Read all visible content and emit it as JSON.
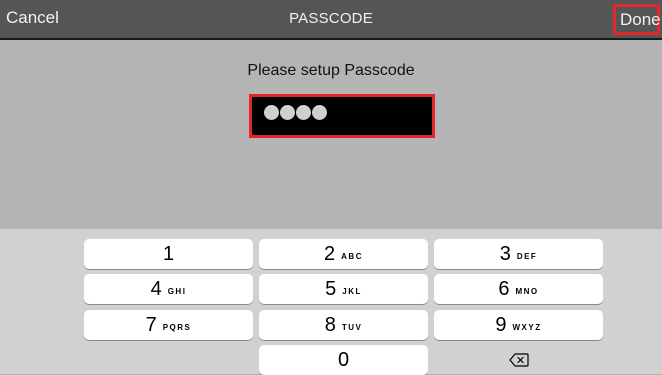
{
  "navbar": {
    "cancel_label": "Cancel",
    "title": "PASSCODE",
    "done_label": "Done"
  },
  "content": {
    "prompt": "Please setup Passcode",
    "passcode_dots": 4
  },
  "keypad": {
    "keys": [
      {
        "num": "1",
        "letters": ""
      },
      {
        "num": "2",
        "letters": "ABC"
      },
      {
        "num": "3",
        "letters": "DEF"
      },
      {
        "num": "4",
        "letters": "GHI"
      },
      {
        "num": "5",
        "letters": "JKL"
      },
      {
        "num": "6",
        "letters": "MNO"
      },
      {
        "num": "7",
        "letters": "PQRS"
      },
      {
        "num": "8",
        "letters": "TUV"
      },
      {
        "num": "9",
        "letters": "WXYZ"
      },
      {
        "num": "0",
        "letters": ""
      }
    ],
    "delete_icon": "backspace-icon"
  },
  "colors": {
    "highlight": "#e3262b",
    "navbar_bg": "#555555",
    "content_bg": "#b4b4b4",
    "keyboard_bg": "#d1d1d1"
  }
}
